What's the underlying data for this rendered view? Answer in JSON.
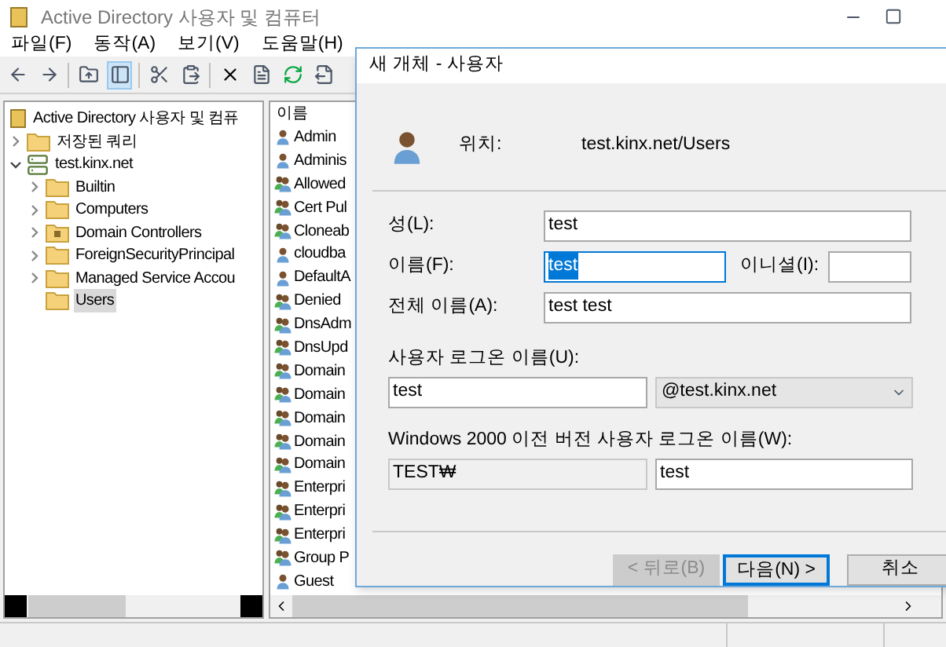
{
  "window": {
    "title": "Active Directory 사용자 및 컴퓨터"
  },
  "menu": [
    "파일(F)",
    "동작(A)",
    "보기(V)",
    "도움말(H)"
  ],
  "toolbar": [
    {
      "kind": "back",
      "pressed": false
    },
    {
      "kind": "forward",
      "pressed": false
    },
    {
      "kind": "sep"
    },
    {
      "kind": "up",
      "pressed": false
    },
    {
      "kind": "pane",
      "pressed": true
    },
    {
      "kind": "sep"
    },
    {
      "kind": "cut",
      "pressed": false
    },
    {
      "kind": "paste",
      "pressed": false
    },
    {
      "kind": "sep"
    },
    {
      "kind": "delete",
      "pressed": false
    },
    {
      "kind": "props",
      "pressed": false
    },
    {
      "kind": "refresh",
      "pressed": false
    },
    {
      "kind": "export",
      "pressed": false
    }
  ],
  "tree": {
    "label": "Active Directory 사용자 및 컴퓨",
    "children": [
      {
        "label": "저장된 쿼리",
        "kind": "folder",
        "expanded": false,
        "selected": false
      },
      {
        "label": "test.kinx.net",
        "kind": "domain",
        "expanded": true,
        "selected": false,
        "children": [
          {
            "label": "Builtin",
            "kind": "folder",
            "expanded": false,
            "selected": false
          },
          {
            "label": "Computers",
            "kind": "folder",
            "expanded": false,
            "selected": false
          },
          {
            "label": "Domain Controllers",
            "kind": "ou",
            "expanded": false,
            "selected": false
          },
          {
            "label": "ForeignSecurityPrincipal",
            "kind": "folder",
            "expanded": false,
            "selected": false
          },
          {
            "label": "Managed Service Accou",
            "kind": "folder",
            "expanded": false,
            "selected": false
          },
          {
            "label": "Users",
            "kind": "folder",
            "selected": true
          }
        ]
      }
    ]
  },
  "list": {
    "columns": [
      "이름"
    ],
    "rows": [
      {
        "name": "Admin",
        "kind": "user"
      },
      {
        "name": "Adminis",
        "kind": "user"
      },
      {
        "name": "Allowed",
        "kind": "group"
      },
      {
        "name": "Cert Pul",
        "kind": "group"
      },
      {
        "name": "Cloneab",
        "kind": "group"
      },
      {
        "name": "cloudba",
        "kind": "user"
      },
      {
        "name": "DefaultA",
        "kind": "user"
      },
      {
        "name": "Denied",
        "kind": "group"
      },
      {
        "name": "DnsAdm",
        "kind": "group"
      },
      {
        "name": "DnsUpd",
        "kind": "group"
      },
      {
        "name": "Domain",
        "kind": "group"
      },
      {
        "name": "Domain",
        "kind": "group"
      },
      {
        "name": "Domain",
        "kind": "group"
      },
      {
        "name": "Domain",
        "kind": "group"
      },
      {
        "name": "Domain",
        "kind": "group"
      },
      {
        "name": "Enterpri",
        "kind": "group"
      },
      {
        "name": "Enterpri",
        "kind": "group"
      },
      {
        "name": "Enterpri",
        "kind": "group"
      },
      {
        "name": "Group P",
        "kind": "group"
      },
      {
        "name": "Guest",
        "kind": "user"
      }
    ]
  },
  "dialog": {
    "title": "새 개체 - 사용자",
    "location_label": "위치:",
    "location": "test.kinx.net/Users",
    "last_name": {
      "label": "성(L):",
      "value": "test"
    },
    "first_name": {
      "label": "이름(F):",
      "value": "test",
      "selected": true
    },
    "initials": {
      "label": "이니셜(I):"
    },
    "full_name": {
      "label": "전체 이름(A):",
      "value": "test test"
    },
    "logon": {
      "label": "사용자 로그온 이름(U):",
      "value": "test",
      "domain": "@test.kinx.net"
    },
    "legacy": {
      "label": "Windows 2000 이전 버전 사용자 로그온 이름(W):",
      "prefix": "TEST₩",
      "value": "test"
    },
    "buttons": [
      {
        "label": "< 뒤로(B)",
        "disabled": true,
        "default": false
      },
      {
        "label": "다음(N) >",
        "disabled": false,
        "default": true
      },
      {
        "label": "취소",
        "disabled": false,
        "default": false
      }
    ]
  }
}
